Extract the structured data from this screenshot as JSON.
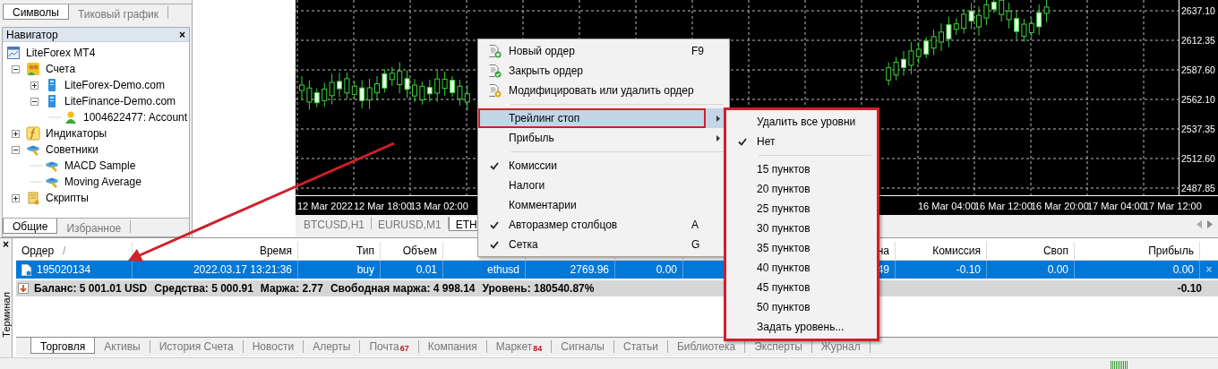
{
  "symbols_panel": {
    "tabs": [
      {
        "label": "Символы",
        "selected": true
      },
      {
        "label": "Тиковый график",
        "selected": false
      }
    ]
  },
  "navigator": {
    "title": "Навигатор",
    "close": "×",
    "tree": [
      {
        "label": "LiteForex MT4",
        "kind": "platform",
        "children": [
          {
            "label": "Счета",
            "kind": "accounts",
            "expanded": true,
            "children": [
              {
                "label": "LiteForex-Demo.com",
                "kind": "server",
                "expanded": false
              },
              {
                "label": "LiteFinance-Demo.com",
                "kind": "server",
                "expanded": true,
                "children": [
                  {
                    "label": "1004622477: Account",
                    "kind": "account"
                  }
                ]
              }
            ]
          },
          {
            "label": "Индикаторы",
            "kind": "indicators",
            "expanded": false
          },
          {
            "label": "Советники",
            "kind": "experts",
            "expanded": true,
            "children": [
              {
                "label": "MACD Sample",
                "kind": "expert"
              },
              {
                "label": "Moving Average",
                "kind": "expert"
              }
            ]
          },
          {
            "label": "Скрипты",
            "kind": "scripts",
            "expanded": false
          }
        ]
      }
    ],
    "tabs": [
      {
        "label": "Общие",
        "selected": true
      },
      {
        "label": "Избранное",
        "selected": false
      }
    ]
  },
  "chart": {
    "price_axis": [
      "2637.10",
      "2612.35",
      "2587.60",
      "2562.10",
      "2537.35",
      "2512.60",
      "2487.85"
    ],
    "time_axis": [
      "12 Mar 2022",
      "12 Mar 18:00",
      "13 Mar 02:00",
      "16 Mar 04:00",
      "16 Mar 12:00",
      "16 Mar 20:00",
      "17 Mar 04:00",
      "17 Mar 12:00"
    ],
    "tabs": [
      {
        "label": "BTCUSD,H1",
        "selected": false
      },
      {
        "label": "EURUSD,M1",
        "selected": false
      },
      {
        "label": "ETH",
        "selected": true
      }
    ]
  },
  "menu": {
    "items": [
      {
        "kind": "command",
        "label": "Новый ордер",
        "shortcut": "F9",
        "selected": false
      },
      {
        "kind": "command",
        "label": "Закрыть ордер",
        "selected": false
      },
      {
        "kind": "command",
        "label": "Модифицировать или удалить ордер",
        "selected": false
      },
      {
        "kind": "separator"
      },
      {
        "kind": "submenu",
        "label": "Трейлинг стоп",
        "selected": true,
        "annotated": true
      },
      {
        "kind": "submenu",
        "label": "Прибыль",
        "selected": false,
        "annotated": false
      },
      {
        "kind": "separator"
      },
      {
        "kind": "toggle",
        "label": "Комиссии",
        "checked": true,
        "selected": false
      },
      {
        "kind": "toggle",
        "label": "Налоги",
        "checked": false,
        "selected": false
      },
      {
        "kind": "toggle",
        "label": "Комментарии",
        "checked": false,
        "selected": false
      },
      {
        "kind": "toggle",
        "label": "Авторазмер столбцов",
        "checked": true,
        "shortcut": "A",
        "selected": false
      },
      {
        "kind": "toggle",
        "label": "Сетка",
        "checked": true,
        "shortcut": "G",
        "selected": false
      }
    ]
  },
  "submenu": {
    "annotated": true,
    "items": [
      {
        "kind": "command",
        "label": "Удалить все уровни",
        "selected": false
      },
      {
        "kind": "toggle",
        "label": "Нет",
        "checked": true,
        "selected": false
      },
      {
        "kind": "separator"
      },
      {
        "kind": "toggle",
        "label": "15 пунктов",
        "checked": false,
        "selected": false
      },
      {
        "kind": "toggle",
        "label": "20 пунктов",
        "checked": false,
        "selected": false
      },
      {
        "kind": "toggle",
        "label": "25 пунктов",
        "checked": false,
        "selected": false
      },
      {
        "kind": "toggle",
        "label": "30 пунктов",
        "checked": false,
        "selected": false
      },
      {
        "kind": "toggle",
        "label": "35 пунктов",
        "checked": false,
        "selected": false
      },
      {
        "kind": "toggle",
        "label": "40 пунктов",
        "checked": false,
        "selected": false
      },
      {
        "kind": "toggle",
        "label": "45 пунктов",
        "checked": false,
        "selected": false
      },
      {
        "kind": "toggle",
        "label": "50 пунктов",
        "checked": false,
        "selected": false
      },
      {
        "kind": "command",
        "label": "Задать уровень...",
        "selected": false
      }
    ]
  },
  "terminal": {
    "title": "Терминал",
    "close": "×",
    "columns": [
      {
        "label": "Ордер",
        "sort_mark": "/"
      },
      {
        "label": "Время"
      },
      {
        "label": "Тип"
      },
      {
        "label": "Объем"
      },
      {},
      {},
      {},
      {},
      {
        "label": "на"
      },
      {
        "label": "Комиссия"
      },
      {
        "label": "Своп"
      },
      {
        "label": "Прибыль"
      }
    ],
    "rows": [
      {
        "selected": true,
        "close": "×",
        "cells": [
          "195020134",
          "2022.03.17 13:21:36",
          "buy",
          "0.01",
          "ethusd",
          "2769.96",
          "0.00",
          null,
          "49",
          "-0.10",
          "0.00",
          "0.00"
        ]
      }
    ],
    "summary": {
      "items": [
        "Баланс: 5 001.01 USD",
        "Средства: 5 000.91",
        "Маржа: 2.77",
        "Свободная маржа: 4 998.14",
        "Уровень: 180540.87%"
      ],
      "total": "-0.10"
    },
    "tabs": [
      {
        "label": "Торговля",
        "selected": true
      },
      {
        "label": "Активы",
        "selected": false
      },
      {
        "label": "История Счета",
        "selected": false
      },
      {
        "label": "Новости",
        "selected": false
      },
      {
        "label": "Алерты",
        "selected": false
      },
      {
        "label": "Почта",
        "badge": "67",
        "selected": false
      },
      {
        "label": "Компания",
        "selected": false
      },
      {
        "label": "Маркет",
        "badge": "84",
        "selected": false
      },
      {
        "label": "Сигналы",
        "selected": false
      },
      {
        "label": "Статьи",
        "selected": false
      },
      {
        "label": "Библиотека",
        "selected": false
      },
      {
        "label": "Эксперты",
        "selected": false
      },
      {
        "label": "Журнал",
        "selected": false
      }
    ]
  }
}
